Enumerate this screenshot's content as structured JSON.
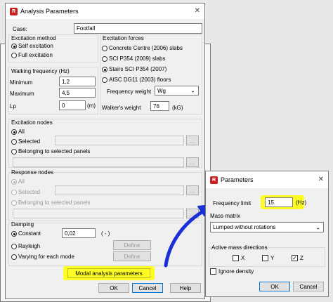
{
  "analysis_dialog": {
    "title": "Analysis Parameters",
    "case_label": "Case:",
    "case_value": "Footfall",
    "excitation_method": {
      "legend": "Excitation method",
      "options": [
        "Self excitation",
        "Full excitation"
      ],
      "selected": "Self excitation"
    },
    "walking_frequency": {
      "legend": "Walking frequency (Hz)",
      "minimum_label": "Minimum",
      "minimum_value": "1,2",
      "maximum_label": "Maximum",
      "maximum_value": "4,5",
      "lp_label": "Lp",
      "lp_value": "0",
      "lp_unit": "(m)"
    },
    "excitation_forces": {
      "legend": "Excitation forces",
      "options": [
        "Concrete Centre (2006) slabs",
        "SCI P354 (2009) slabs",
        "Stairs SCI P354 (2007)",
        "AISC DG11 (2003) floors"
      ],
      "selected": "Stairs SCI P354 (2007)",
      "frequency_weight_label": "Frequency weight",
      "frequency_weight_value": "Wg",
      "walkers_weight_label": "Walker's weight",
      "walkers_weight_value": "76",
      "walkers_weight_unit": "(kG)"
    },
    "excitation_nodes": {
      "legend": "Excitation nodes",
      "options": [
        "All",
        "Selected",
        "Belonging to selected panels"
      ],
      "selected": "All",
      "browse_label": "..."
    },
    "response_nodes": {
      "legend": "Response nodes",
      "options": [
        "All",
        "Selected",
        "Belonging to selected panels"
      ],
      "selected": "All",
      "browse_label": "..."
    },
    "damping": {
      "legend": "Damping",
      "options": [
        "Constant",
        "Rayleigh",
        "Varying for each mode"
      ],
      "selected": "Constant",
      "constant_value": "0,02",
      "constant_unit": "( - )",
      "define_label": "Define"
    },
    "modal_button": "Modal analysis parameters",
    "ok": "OK",
    "cancel": "Cancel",
    "help": "Help",
    "close_glyph": "✕"
  },
  "parameters_dialog": {
    "title": "Parameters",
    "frequency_limit_label": "Frequency limit",
    "frequency_limit_value": "15",
    "frequency_limit_unit": "(Hz)",
    "mass_matrix_label": "Mass matrix",
    "mass_matrix_value": "Lumped without rotations",
    "active_mass_label": "Active mass directions",
    "directions": [
      {
        "label": "X",
        "checked": false
      },
      {
        "label": "Y",
        "checked": false
      },
      {
        "label": "Z",
        "checked": true
      }
    ],
    "ignore_density_label": "Ignore density",
    "ok": "OK",
    "cancel": "Cancel",
    "close_glyph": "✕"
  },
  "colors": {
    "highlight": "#ffff00",
    "annotation_arrow": "#1a2fd6",
    "app_icon": "#c62020"
  }
}
